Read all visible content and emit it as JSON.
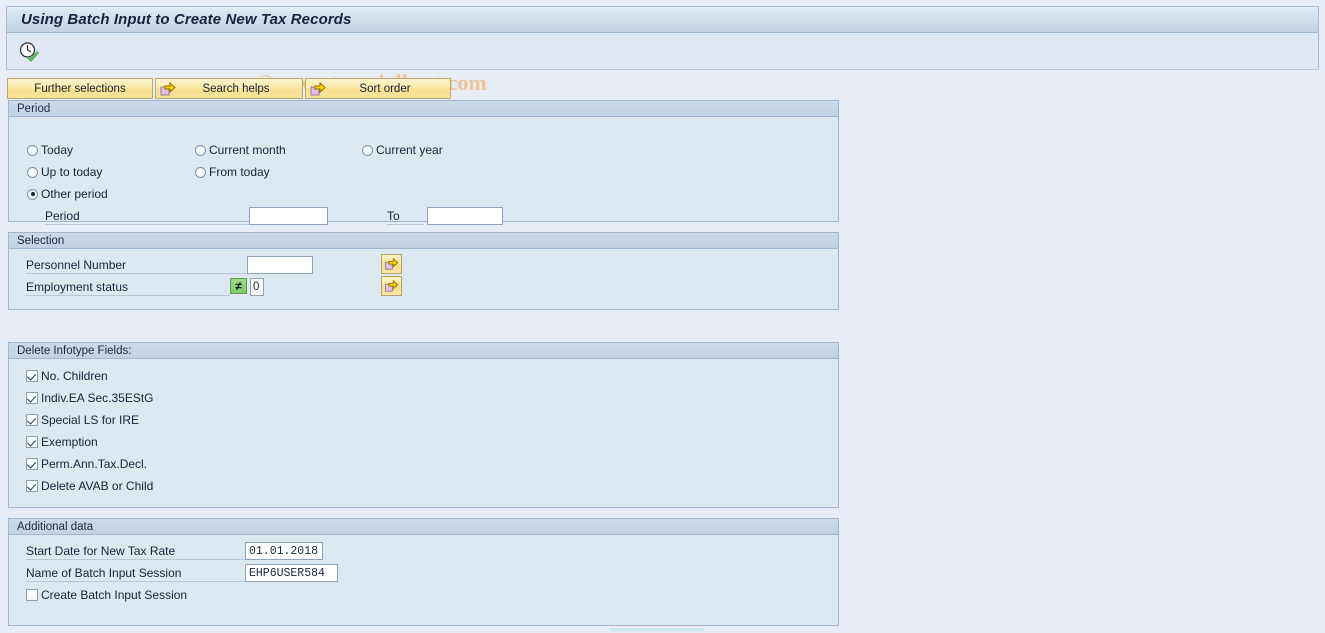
{
  "window": {
    "title": "Using Batch Input to Create New Tax Records",
    "watermark": "© www.tutorialkart.com",
    "execute_icon": "clock-check-icon"
  },
  "toolbar": {
    "buttons": [
      {
        "label": "Further selections",
        "icon": null
      },
      {
        "label": "Search helps",
        "icon": "arrow-right-icon"
      },
      {
        "label": "Sort order",
        "icon": "arrow-right-icon"
      }
    ]
  },
  "period": {
    "header": "Period",
    "radios": [
      {
        "label": "Today",
        "selected": false
      },
      {
        "label": "Current month",
        "selected": false
      },
      {
        "label": "Current year",
        "selected": false
      },
      {
        "label": "Up to today",
        "selected": false
      },
      {
        "label": "From today",
        "selected": false
      },
      {
        "label": "Other period",
        "selected": true
      }
    ],
    "period_label": "Period",
    "period_value": "",
    "to_label": "To",
    "to_value": ""
  },
  "selection": {
    "header": "Selection",
    "personnel_number_label": "Personnel Number",
    "personnel_number_value": "",
    "employment_status_label": "Employment status",
    "employment_status_operator": "≠",
    "employment_status_value": "0",
    "multi_select_icon": "arrow-right-icon"
  },
  "delete_fields": {
    "header": "Delete Infotype Fields:",
    "items": [
      {
        "label": "No. Children",
        "checked": true
      },
      {
        "label": "Indiv.EA Sec.35EStG",
        "checked": true
      },
      {
        "label": "Special LS for IRE",
        "checked": true
      },
      {
        "label": "Exemption",
        "checked": true
      },
      {
        "label": "Perm.Ann.Tax.Decl.",
        "checked": true
      },
      {
        "label": "Delete AVAB or Child",
        "checked": true
      }
    ]
  },
  "additional_data": {
    "header": "Additional data",
    "start_date_label": "Start Date for New Tax Rate",
    "start_date_value": "01.01.2018",
    "session_name_label": "Name of Batch Input Session",
    "session_name_value": "EHP6USER584",
    "create_session_label": "Create Batch Input Session",
    "create_session_checked": false
  },
  "colors": {
    "background": "#e8edf5",
    "panel_body": "#dee8f1",
    "panel_header": "#c7d6e8",
    "title_text": "#14243d",
    "button_yellow": "#f9e49a",
    "watermark": "#f0c496",
    "operator_green": "#7ec96b"
  }
}
